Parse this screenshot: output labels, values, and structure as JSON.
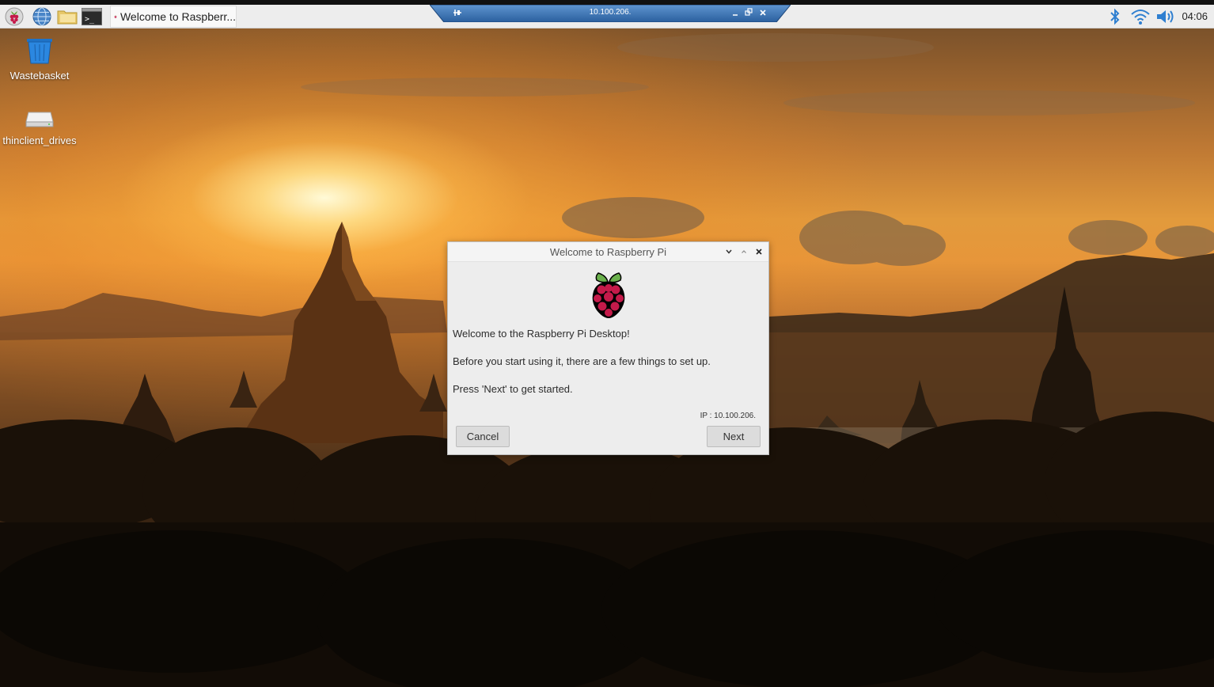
{
  "taskbar": {
    "launchers": [
      "raspberry-menu-icon",
      "web-browser-icon",
      "file-manager-icon",
      "terminal-icon"
    ],
    "window_button_label": "Welcome to Raspberr...",
    "tray": [
      "bluetooth-icon",
      "wifi-icon",
      "volume-icon"
    ],
    "clock": "04:06"
  },
  "remote_bar": {
    "title": "10.100.206."
  },
  "desktop": {
    "icons": [
      {
        "label": "Wastebasket",
        "icon": "wastebasket-icon"
      },
      {
        "label": "thinclient_drives",
        "icon": "drive-icon"
      }
    ]
  },
  "dialog": {
    "title": "Welcome to Raspberry Pi",
    "heading": "Welcome to the Raspberry Pi Desktop!",
    "line1": "Before you start using it, there are a few things to set up.",
    "line2": "Press 'Next' to get started.",
    "ip": "IP : 10.100.206.",
    "cancel_label": "Cancel",
    "next_label": "Next"
  },
  "colors": {
    "taskbar_bg": "#ededed",
    "dialog_bg": "#ededed",
    "remote_bar": "#2f6db3",
    "raspberry_red": "#c51a4a",
    "leaf_green": "#5ea83a"
  }
}
